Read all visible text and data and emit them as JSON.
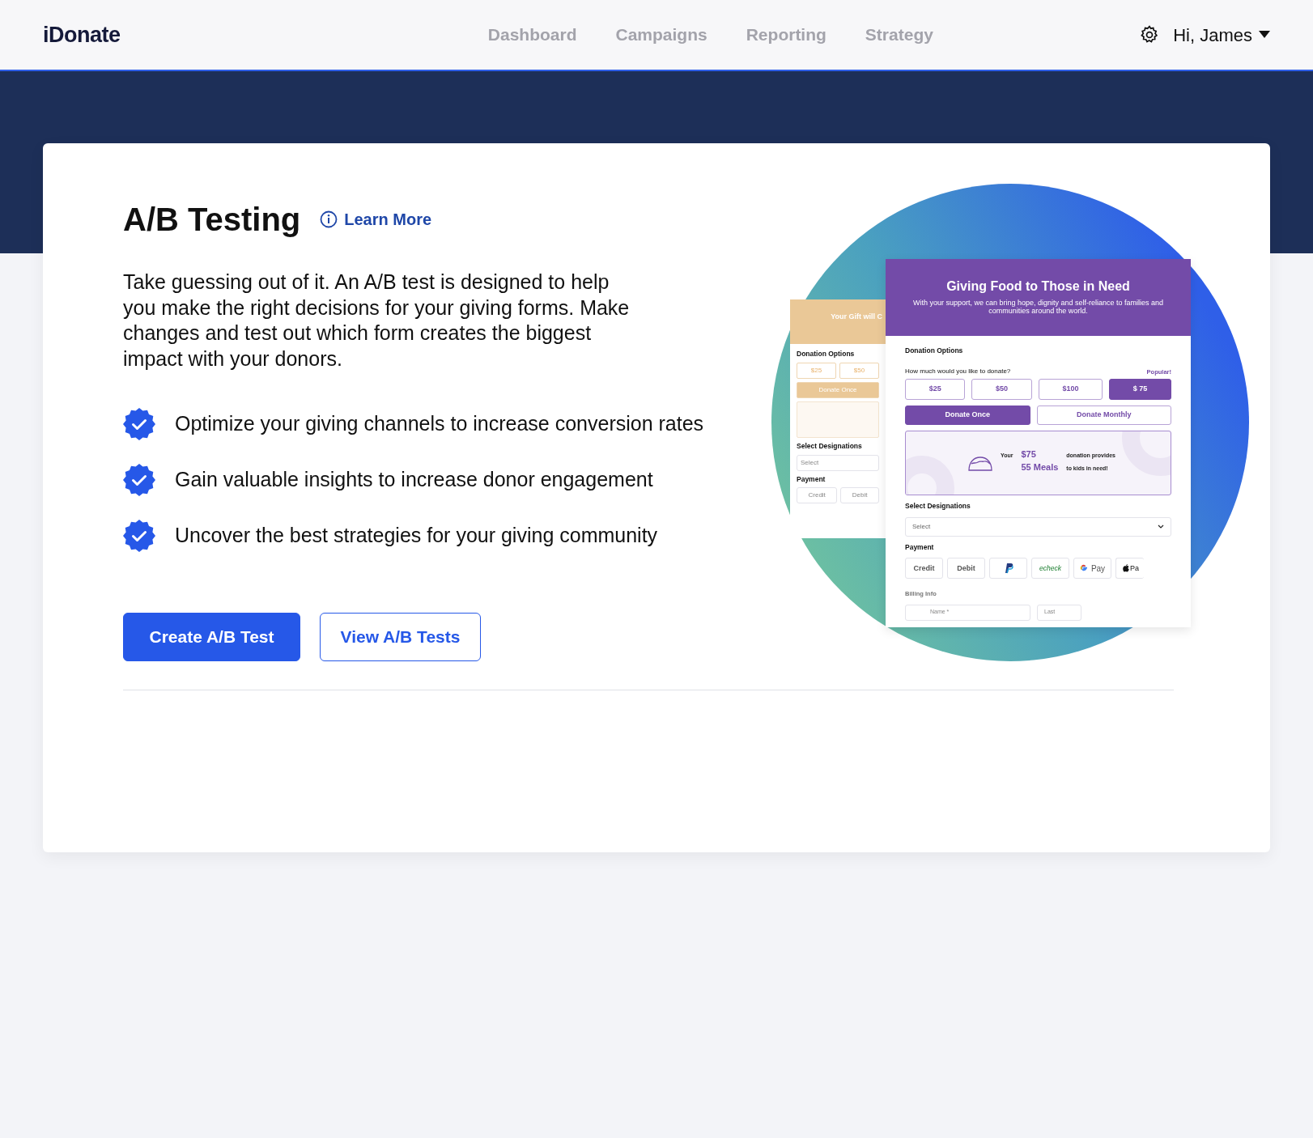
{
  "nav": {
    "logo": "iDonate",
    "links": [
      "Dashboard",
      "Campaigns",
      "Reporting",
      "Strategy"
    ],
    "user": "Hi, James"
  },
  "hero": {
    "title": "A/B Testing",
    "learn_more": "Learn More",
    "description": "Take guessing out of it. An A/B test is designed to help you make the right decisions for your giving forms. Make changes and test out which form creates the biggest impact with your donors.",
    "features": [
      "Optimize your giving channels to increase conversion rates",
      "Gain valuable insights to increase donor engagement",
      "Uncover the best strategies for your giving community"
    ],
    "buttons": [
      {
        "label": "Create A/B Test",
        "kind": "primary"
      },
      {
        "label": "View A/B Tests",
        "kind": "outline"
      }
    ]
  },
  "illustration": {
    "back_form": {
      "title": "Your Gift will C",
      "options_label": "Donation Options",
      "amounts": [
        "$25",
        "$50"
      ],
      "frequency": "Donate Once",
      "designations_label": "Select Designations",
      "select_placeholder": "Select",
      "payment_label": "Payment",
      "payment_methods": [
        "Credit",
        "Debit"
      ]
    },
    "front_form": {
      "title": "Giving Food to Those in Need",
      "subtitle": "With your support, we can bring hope, dignity and self-reliance to families and communities around the world.",
      "options_label": "Donation Options",
      "question": "How much would you like to donate?",
      "popular": "Popular!",
      "amounts": [
        {
          "label": "$25",
          "selected": false
        },
        {
          "label": "$50",
          "selected": false
        },
        {
          "label": "$100",
          "selected": false
        },
        {
          "label": "$ 75",
          "selected": true
        }
      ],
      "frequency": [
        {
          "label": "Donate Once",
          "selected": true
        },
        {
          "label": "Donate Monthly",
          "selected": false
        }
      ],
      "impact": {
        "prefix": "Your",
        "amount": "$75",
        "middle": "donation provides",
        "meals": "55 Meals",
        "suffix": "to kids in need!"
      },
      "designations_label": "Select Designations",
      "select_placeholder": "Select",
      "payment_label": "Payment",
      "payment_methods": [
        {
          "kind": "text",
          "label": "Credit"
        },
        {
          "kind": "text",
          "label": "Debit"
        },
        {
          "kind": "paypal"
        },
        {
          "kind": "echeck",
          "label": "echeck"
        },
        {
          "kind": "gpay",
          "label": "Pay"
        },
        {
          "kind": "applepay",
          "label": "Pa"
        }
      ],
      "billing_label": "Billing Info",
      "billing_fields": [
        "Name *",
        "Last"
      ]
    }
  }
}
